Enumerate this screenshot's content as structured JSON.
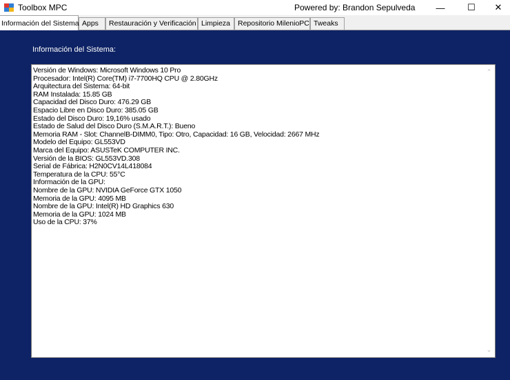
{
  "window": {
    "title": "Toolbox MPC",
    "powered_by": "Powered by: Brandon Sepulveda",
    "minimize_glyph": "—",
    "maximize_glyph": "☐",
    "close_glyph": "✕"
  },
  "tabs": [
    {
      "label": "Información del Sistema",
      "active": true
    },
    {
      "label": "Apps"
    },
    {
      "label": "Restauración y Verificación"
    },
    {
      "label": "Limpieza"
    },
    {
      "label": "Repositorio MilenioPC"
    },
    {
      "label": "Tweaks"
    }
  ],
  "panel": {
    "label": "Información del Sistema:",
    "background": "#0e2365"
  },
  "info_lines": [
    "Versión de Windows: Microsoft Windows 10 Pro",
    "Procesador: Intel(R) Core(TM) i7-7700HQ CPU @ 2.80GHz",
    "Arquitectura del Sistema: 64-bit",
    "RAM Instalada: 15.85 GB",
    "Capacidad del Disco Duro: 476.29 GB",
    "Espacio Libre en Disco Duro: 385.05 GB",
    "Estado del Disco Duro: 19,16% usado",
    "Estado de Salud del Disco Duro (S.M.A.R.T.): Bueno",
    "Memoria RAM - Slot: ChannelB-DIMM0, Tipo: Otro, Capacidad: 16 GB, Velocidad: 2667 MHz",
    "Modelo del Equipo: GL553VD",
    "Marca del Equipo: ASUSTeK COMPUTER INC.",
    "Versión de la BIOS: GL553VD.308",
    "Serial de Fábrica: H2N0CV14L418084",
    "Temperatura de la CPU: 55°C",
    "Información de la GPU:",
    "Nombre de la GPU: NVIDIA GeForce GTX 1050",
    "Memoria de la GPU: 4095 MB",
    "Nombre de la GPU: Intel(R) HD Graphics 630",
    "Memoria de la GPU: 1024 MB",
    "Uso de la CPU: 37%"
  ],
  "scrollbar": {
    "up_glyph": "⌃",
    "down_glyph": "⌄"
  }
}
